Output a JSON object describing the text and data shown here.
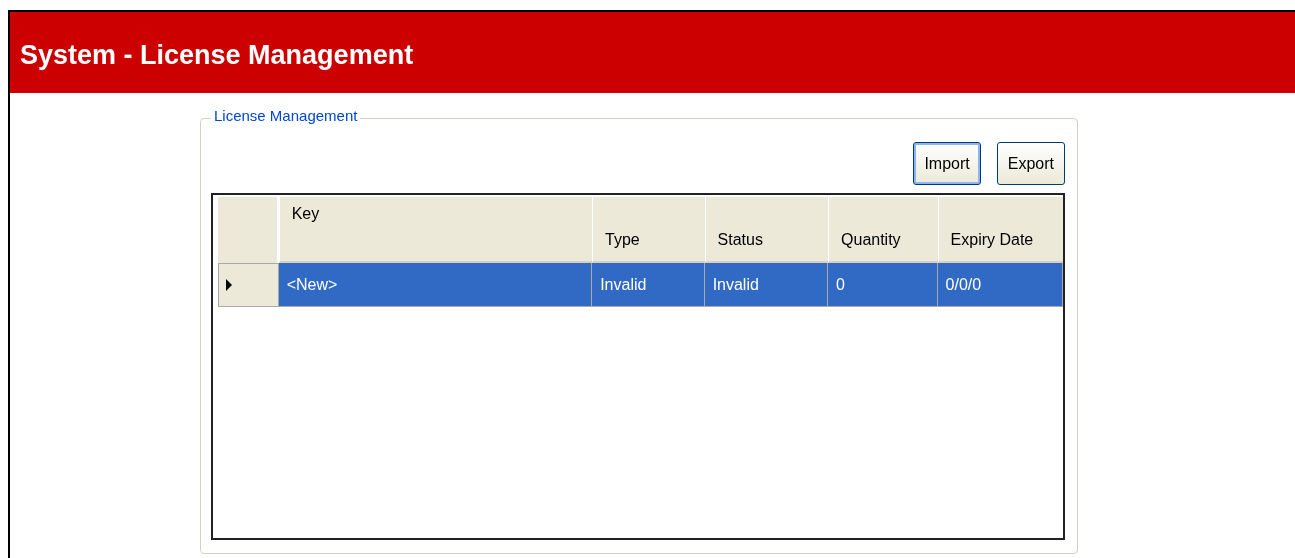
{
  "header": {
    "title": "System - License Management"
  },
  "group": {
    "legend": "License Management"
  },
  "buttons": [
    {
      "label": "Import",
      "focused": true
    },
    {
      "label": "Export",
      "focused": false
    }
  ],
  "table": {
    "columns": [
      "Key",
      "Type",
      "Status",
      "Quantity",
      "Expiry Date"
    ],
    "rows": [
      {
        "selected": true,
        "current": true,
        "cells": [
          "<New>",
          "Invalid",
          "Invalid",
          "0",
          "0/0/0"
        ]
      }
    ]
  }
}
